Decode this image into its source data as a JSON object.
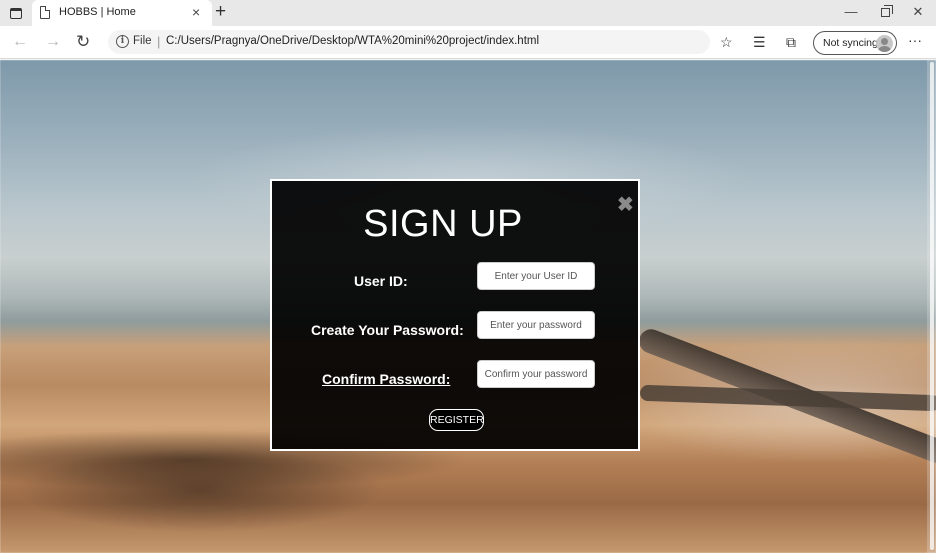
{
  "browser": {
    "tab": {
      "title": "HOBBS | Home",
      "close": "×"
    },
    "new_tab": "+",
    "window_controls": {
      "minimize": "—",
      "close": "✕"
    },
    "nav": {
      "back": "←",
      "forward": "→",
      "reload": "↻"
    },
    "address": {
      "scheme_label": "File",
      "separator": "|",
      "url": "C:/Users/Pragnya/OneDrive/Desktop/WTA%20mini%20project/index.html"
    },
    "toolbar": {
      "favorite_icon": "☆",
      "favorites_list_icon": "☰",
      "collections_icon": "⧉",
      "sync_label": "Not syncing",
      "more": "···"
    }
  },
  "modal": {
    "title": "SIGN UP",
    "close": "✖",
    "fields": [
      {
        "label": "User ID:",
        "placeholder": "Enter your User ID"
      },
      {
        "label": "Create Your Password:",
        "placeholder": "Enter your password"
      },
      {
        "label": "Confirm Password:",
        "placeholder": "Confirm your password"
      }
    ],
    "submit_label": "REGISTER"
  }
}
